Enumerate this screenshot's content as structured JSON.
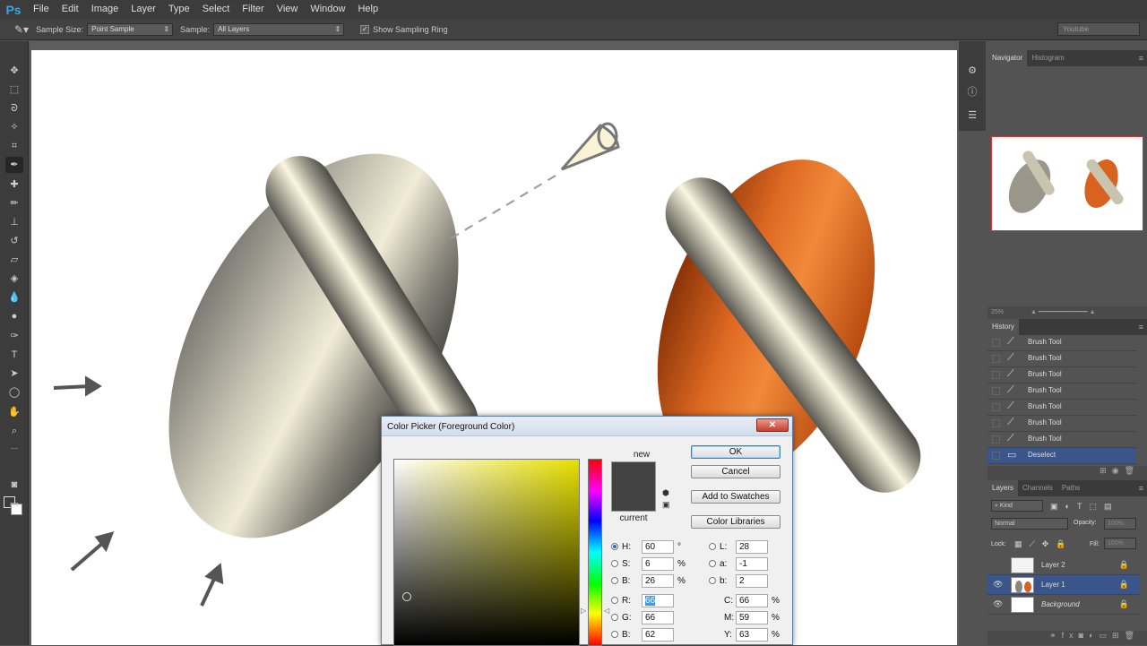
{
  "app": {
    "logo": "Ps"
  },
  "menu": [
    "File",
    "Edit",
    "Image",
    "Layer",
    "Type",
    "Select",
    "Filter",
    "View",
    "Window",
    "Help"
  ],
  "options_bar": {
    "sample_size_label": "Sample Size:",
    "sample_size_value": "Point Sample",
    "sample_label": "Sample:",
    "sample_value": "All Layers",
    "show_ring_checked": "✓",
    "show_ring_label": "Show Sampling Ring",
    "workspace": "Youtube"
  },
  "navigator": {
    "tabs": [
      "Navigator",
      "Histogram"
    ],
    "zoom": "25%"
  },
  "history": {
    "title": "History",
    "items": [
      "Brush Tool",
      "Brush Tool",
      "Brush Tool",
      "Brush Tool",
      "Brush Tool",
      "Brush Tool",
      "Brush Tool",
      "Deselect"
    ],
    "selected_index": 7
  },
  "layers": {
    "tabs": [
      "Layers",
      "Channels",
      "Paths"
    ],
    "kind": "Kind",
    "blend_mode": "Normal",
    "opacity_label": "Opacity:",
    "opacity_value": "100%",
    "lock_label": "Lock:",
    "fill_label": "Fill:",
    "fill_value": "100%",
    "items": [
      "Layer 2",
      "Layer 1",
      "Background"
    ],
    "selected_index": 1
  },
  "color_picker": {
    "title": "Color Picker (Foreground Color)",
    "close": "✕",
    "new_label": "new",
    "current_label": "current",
    "new_color": "#424242",
    "buttons": {
      "ok": "OK",
      "cancel": "Cancel",
      "add_swatches": "Add to Swatches",
      "libraries": "Color Libraries"
    },
    "hsb": {
      "h": "60",
      "h_unit": "°",
      "s": "6",
      "s_unit": "%",
      "b": "26",
      "b_unit": "%"
    },
    "rgb": {
      "r": "66",
      "g": "66",
      "b": "62"
    },
    "lab": {
      "l": "28",
      "a": "-1",
      "b": "2"
    },
    "cmy": {
      "c": "66",
      "m": "59",
      "y": "63",
      "unit": "%"
    },
    "labels": {
      "H": "H:",
      "S": "S:",
      "B": "B:",
      "R": "R:",
      "G": "G:",
      "Bl": "B:",
      "L": "L:",
      "a": "a:",
      "b": "b:",
      "C": "C:",
      "M": "M:",
      "Y": "Y:"
    }
  }
}
